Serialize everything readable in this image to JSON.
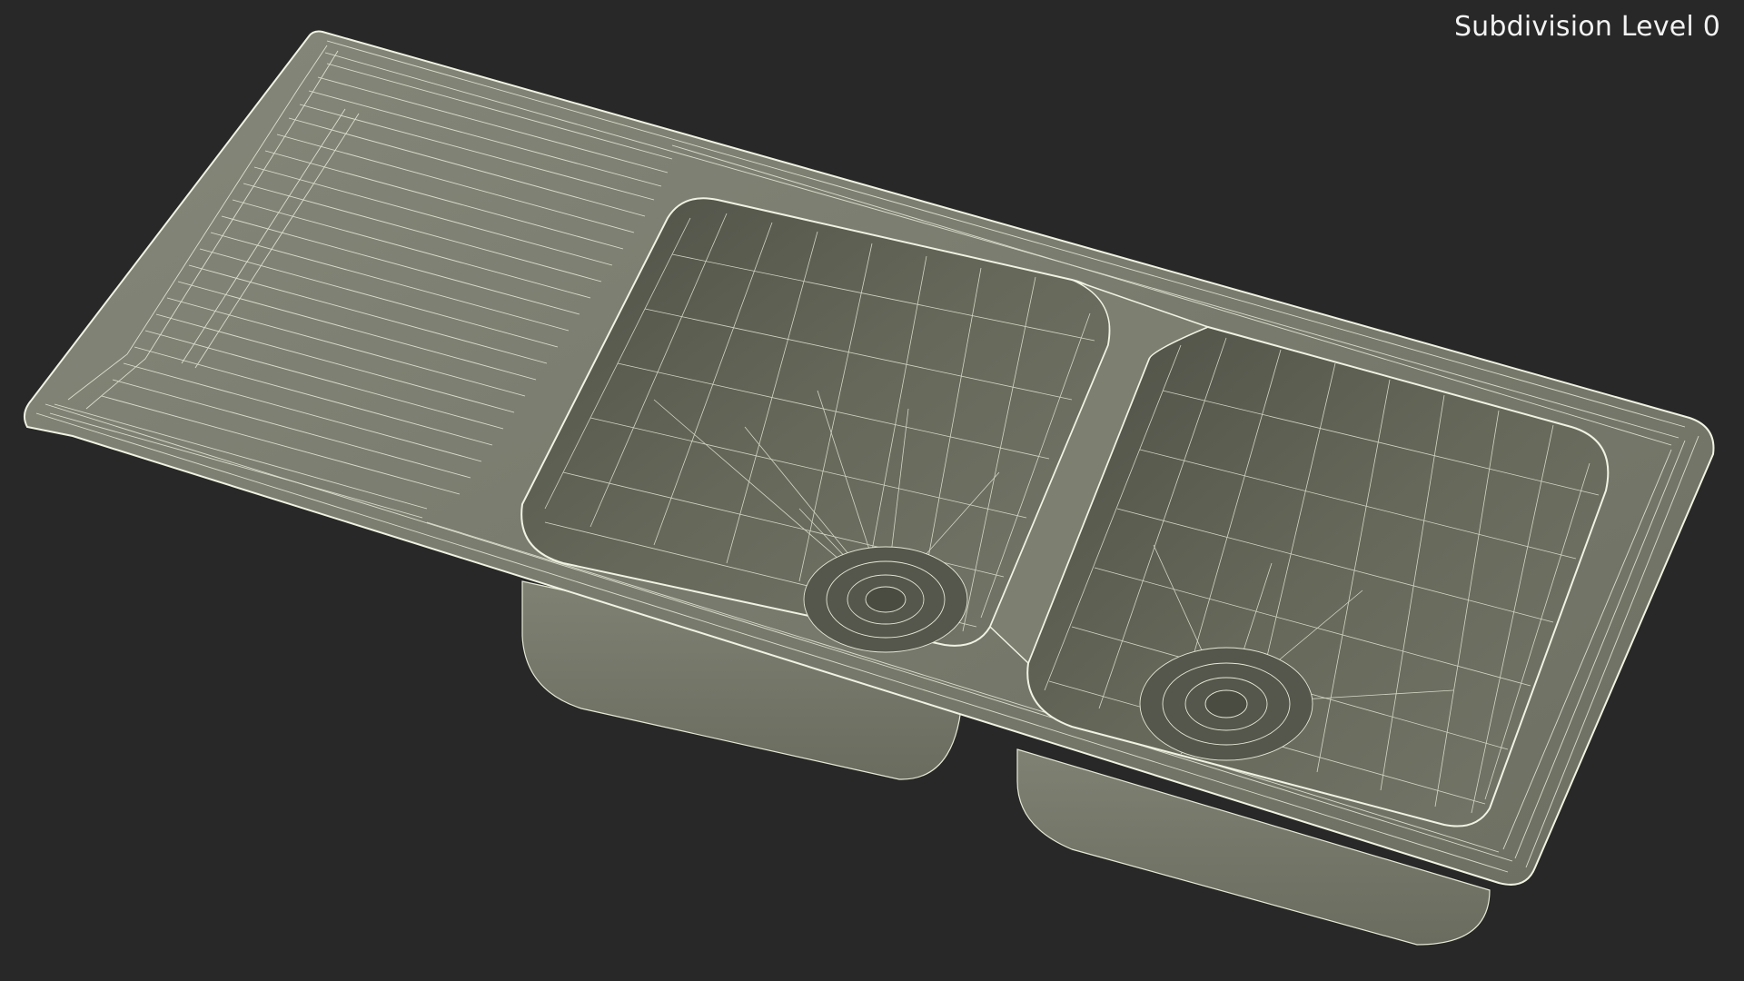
{
  "viewport": {
    "label": "Subdivision Level 0",
    "background_color": "#282828",
    "subject": "double-bowl-sink-wireframe",
    "mesh_fill_color": "#7a7c6c",
    "wire_color": "#e6e8d6"
  }
}
